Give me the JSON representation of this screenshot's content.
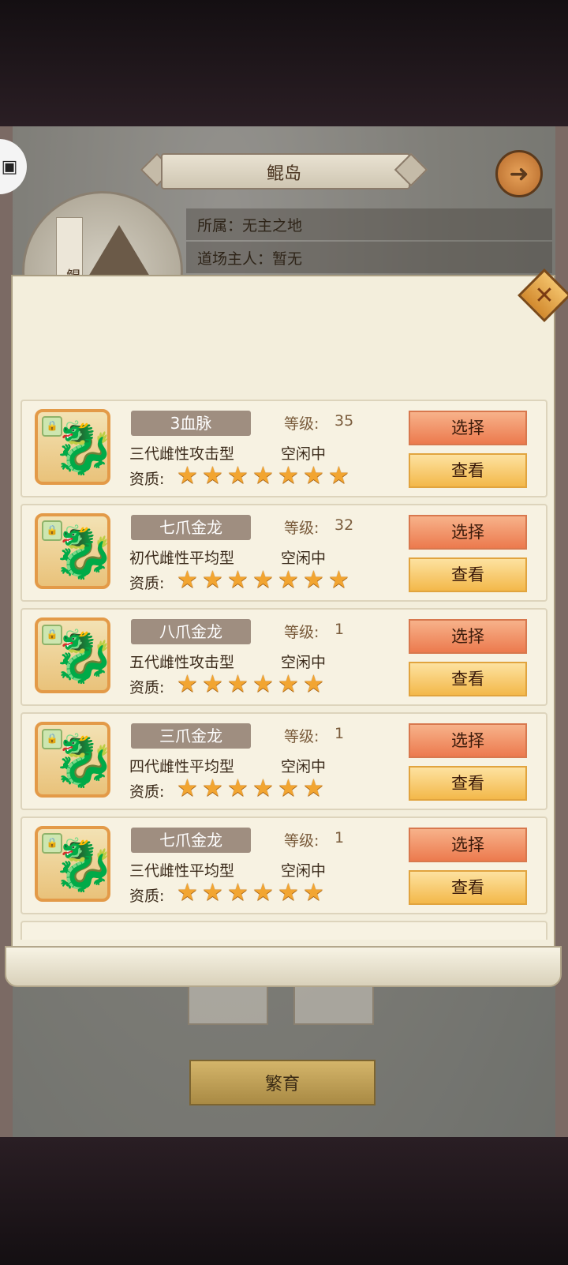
{
  "header": {
    "title": "鲲岛",
    "back_icon": "back-arrow-icon",
    "screenshot_icon": "screenshot-icon"
  },
  "island": {
    "banner_text": "鲲岛",
    "belongs_label": "所属：无主之地",
    "owner_label": "道场主人：暂无"
  },
  "footer": {
    "breed_label": "繁育"
  },
  "dialog": {
    "close_icon": "close-icon",
    "quality_label": "资质:",
    "level_label": "等级:",
    "select_label": "选择",
    "view_label": "查看",
    "star_color": "#f2a531",
    "items": [
      {
        "name": "3血脉",
        "level": "35",
        "type": "三代雌性攻击型",
        "status": "空闲中",
        "stars": 7
      },
      {
        "name": "七爪金龙",
        "level": "32",
        "type": "初代雌性平均型",
        "status": "空闲中",
        "stars": 7
      },
      {
        "name": "八爪金龙",
        "level": "1",
        "type": "五代雌性攻击型",
        "status": "空闲中",
        "stars": 6
      },
      {
        "name": "三爪金龙",
        "level": "1",
        "type": "四代雌性平均型",
        "status": "空闲中",
        "stars": 6
      },
      {
        "name": "七爪金龙",
        "level": "1",
        "type": "三代雌性平均型",
        "status": "空闲中",
        "stars": 6
      }
    ]
  }
}
